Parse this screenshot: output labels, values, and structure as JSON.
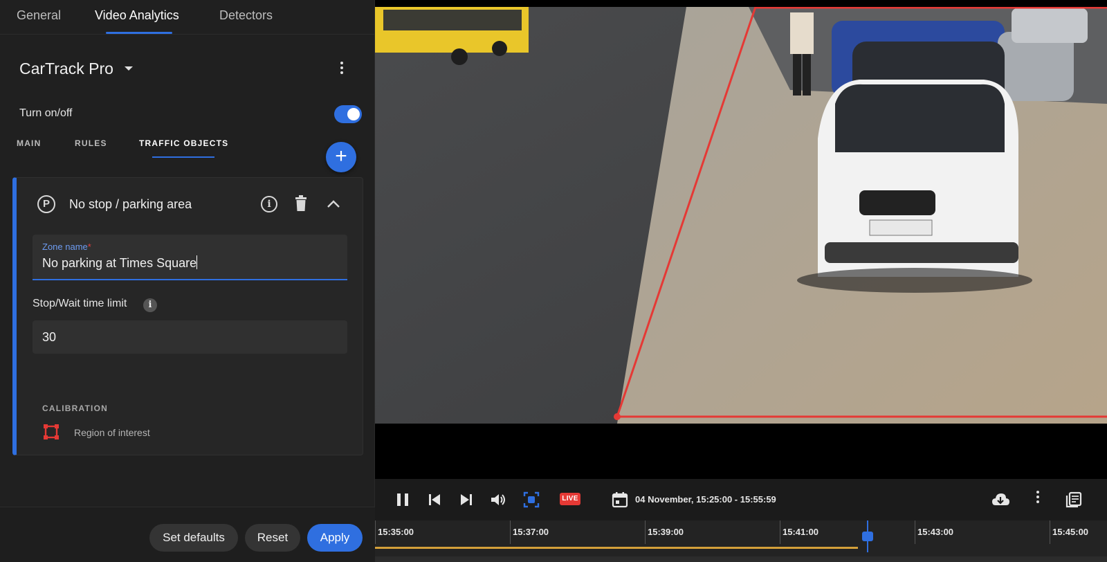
{
  "top_tabs": [
    {
      "label": "General"
    },
    {
      "label": "Video Analytics",
      "active": true
    },
    {
      "label": "Detectors"
    }
  ],
  "detector": {
    "title": "CarTrack Pro",
    "toggle_label": "Turn on/off",
    "enabled": true
  },
  "sub_tabs": [
    {
      "label": "MAIN"
    },
    {
      "label": "RULES"
    },
    {
      "label": "TRAFFIC OBJECTS",
      "active": true
    }
  ],
  "zone_card": {
    "title": "No stop / parking area",
    "zone_name_label": "Zone name",
    "zone_name_required": "*",
    "zone_name_value": "No parking at Times Square",
    "limit_label": "Stop/Wait time limit",
    "limit_value": "30",
    "calibration_label": "CALIBRATION",
    "roi_label": "Region of interest"
  },
  "footer": {
    "set_defaults": "Set defaults",
    "reset": "Reset",
    "apply": "Apply"
  },
  "player": {
    "live_badge": "LIVE",
    "range": "04 November, 15:25:00 - 15:55:59",
    "timeline_labels": [
      "15:35:00",
      "15:37:00",
      "15:39:00",
      "15:41:00",
      "15:43:00",
      "15:45:00"
    ],
    "progress_percent": 66
  },
  "colors": {
    "accent": "#2f6fe0",
    "zone_outline": "#e53935",
    "progress": "#d4a03a"
  }
}
